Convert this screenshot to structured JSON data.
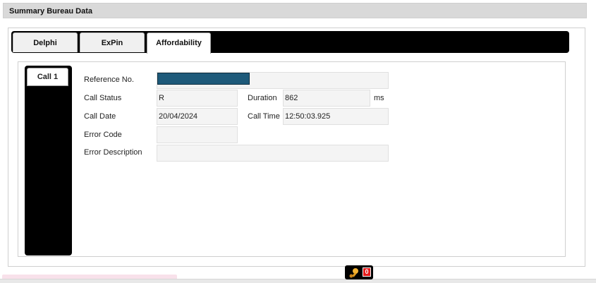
{
  "section": {
    "title": "Summary Bureau Data"
  },
  "tabs": [
    {
      "label": "Delphi"
    },
    {
      "label": "ExPin"
    },
    {
      "label": "Affordability"
    }
  ],
  "active_tab": "Affordability",
  "call_tabs": [
    {
      "label": "Call 1"
    }
  ],
  "form": {
    "reference_label": "Reference No.",
    "reference_value": "",
    "call_status_label": "Call Status",
    "call_status_value": "R",
    "duration_label": "Duration",
    "duration_value": "862",
    "duration_unit": "ms",
    "call_date_label": "Call Date",
    "call_date_value": "20/04/2024",
    "call_time_label": "Call Time",
    "call_time_value": "12:50:03.925",
    "error_code_label": "Error Code",
    "error_code_value": "",
    "error_description_label": "Error Description",
    "error_description_value": ""
  },
  "notifications": {
    "count": "0",
    "icon": "pin-icon"
  },
  "colors": {
    "header_bg": "#d9d9d9",
    "tabbar_bg": "#000000",
    "mask": "#1e5a7a",
    "badge": "#e31b1b"
  }
}
